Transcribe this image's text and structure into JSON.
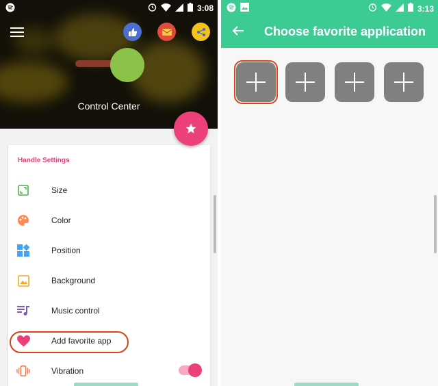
{
  "left_screen": {
    "status": {
      "time": "3:08"
    },
    "header": {
      "title": "Control Center"
    },
    "settings": {
      "section_title": "Handle Settings",
      "items": [
        {
          "label": "Size",
          "icon": "resize-icon"
        },
        {
          "label": "Color",
          "icon": "palette-icon"
        },
        {
          "label": "Position",
          "icon": "grid-icon"
        },
        {
          "label": "Background",
          "icon": "image-icon"
        },
        {
          "label": "Music control",
          "icon": "playlist-icon"
        },
        {
          "label": "Add favorite app",
          "icon": "heart-icon"
        },
        {
          "label": "Vibration",
          "icon": "vibration-icon"
        }
      ],
      "vibration_enabled": true
    }
  },
  "right_screen": {
    "status": {
      "time": "3:13"
    },
    "title": "Choose favorite application",
    "slots": [
      {
        "icon": "plus-icon"
      },
      {
        "icon": "plus-icon"
      },
      {
        "icon": "plus-icon"
      },
      {
        "icon": "plus-icon"
      }
    ]
  },
  "colors": {
    "accent_pink": "#ec407a",
    "toolbar_green": "#3dcb94",
    "highlight_red": "#d84315",
    "slot_gray": "#808080"
  }
}
